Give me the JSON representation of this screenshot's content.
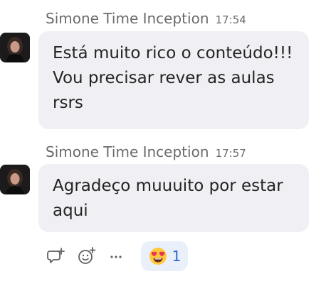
{
  "messages": [
    {
      "sender": "Simone Time Inception",
      "time": "17:54",
      "lines": [
        "Está muito rico o conteúdo!!!",
        "Vou precisar rever as aulas",
        "rsrs"
      ]
    },
    {
      "sender": "Simone Time Inception",
      "time": "17:57",
      "lines": [
        "Agradeço muuuito por estar",
        "aqui"
      ]
    }
  ],
  "reaction": {
    "emoji": "heart-eyes-face",
    "count": "1"
  },
  "colors": {
    "bubble": "#f0f0f4",
    "reaction_bg": "#e9f0fb",
    "accent": "#2f64d8"
  }
}
